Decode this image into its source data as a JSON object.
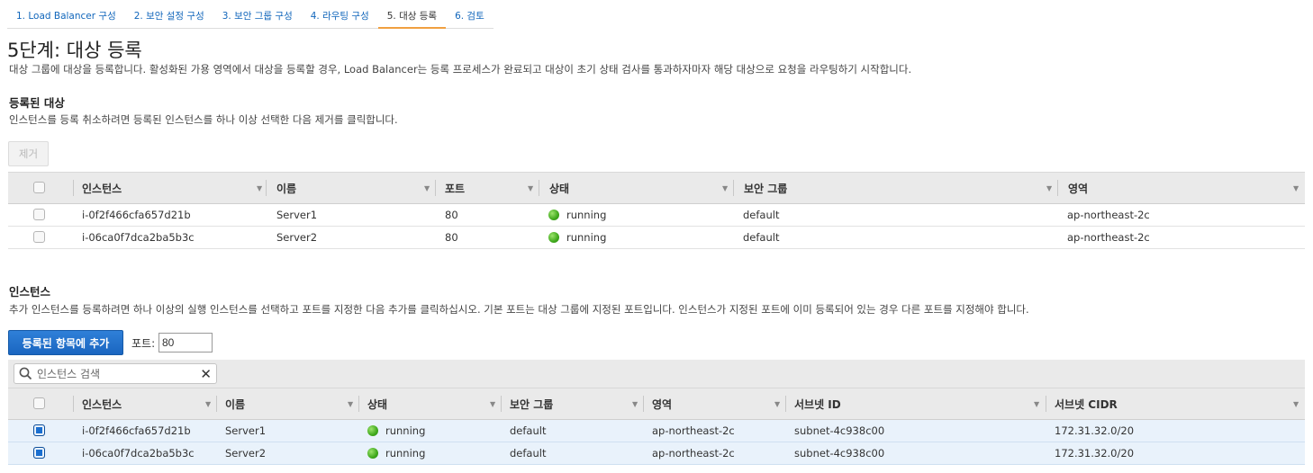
{
  "wizard": {
    "steps": [
      {
        "label": "1. Load Balancer 구성"
      },
      {
        "label": "2. 보안 설정 구성"
      },
      {
        "label": "3. 보안 그룹 구성"
      },
      {
        "label": "4. 라우팅 구성"
      },
      {
        "label": "5. 대상 등록"
      },
      {
        "label": "6. 검토"
      }
    ],
    "active_step": 4
  },
  "page": {
    "title": "5단계: 대상 등록",
    "description": "대상 그룹에 대상을 등록합니다. 활성화된 가용 영역에서 대상을 등록할 경우, Load Balancer는 등록 프로세스가 완료되고 대상이 초기 상태 검사를 통과하자마자 해당 대상으로 요청을 라우팅하기 시작합니다."
  },
  "registered": {
    "title": "등록된 대상",
    "description": "인스턴스를 등록 취소하려면 등록된 인스턴스를 하나 이상 선택한 다음 제거를 클릭합니다.",
    "remove_label": "제거",
    "columns": [
      "인스턴스",
      "이름",
      "포트",
      "상태",
      "보안 그룹",
      "영역"
    ],
    "rows": [
      {
        "instance": "i-0f2f466cfa657d21b",
        "name": "Server1",
        "port": "80",
        "status": "running",
        "security_group": "default",
        "zone": "ap-northeast-2c",
        "checked": false
      },
      {
        "instance": "i-06ca0f7dca2ba5b3c",
        "name": "Server2",
        "port": "80",
        "status": "running",
        "security_group": "default",
        "zone": "ap-northeast-2c",
        "checked": false
      }
    ]
  },
  "instances": {
    "title": "인스턴스",
    "description": "추가 인스턴스를 등록하려면 하나 이상의 실행 인스턴스를 선택하고 포트를 지정한 다음 추가를 클릭하십시오. 기본 포트는 대상 그룹에 지정된 포트입니다. 인스턴스가 지정된 포트에 이미 등록되어 있는 경우 다른 포트를 지정해야 합니다.",
    "add_label": "등록된 항목에 추가",
    "port_label": "포트:",
    "port_value": "80",
    "search_placeholder": "인스턴스 검색",
    "columns": [
      "인스턴스",
      "이름",
      "상태",
      "보안 그룹",
      "영역",
      "서브넷 ID",
      "서브넷 CIDR"
    ],
    "rows": [
      {
        "instance": "i-0f2f466cfa657d21b",
        "name": "Server1",
        "status": "running",
        "security_group": "default",
        "zone": "ap-northeast-2c",
        "subnet_id": "subnet-4c938c00",
        "subnet_cidr": "172.31.32.0/20",
        "checked": true
      },
      {
        "instance": "i-06ca0f7dca2ba5b3c",
        "name": "Server2",
        "status": "running",
        "security_group": "default",
        "zone": "ap-northeast-2c",
        "subnet_id": "subnet-4c938c00",
        "subnet_cidr": "172.31.32.0/20",
        "checked": true
      }
    ]
  },
  "colors": {
    "link": "#1166bb",
    "primary_button": "#1a66c0",
    "running": "#3fa81c",
    "selected_row": "#e9f2fb"
  },
  "icons": {
    "status": "green-dot-icon",
    "sort": "sort-down-icon",
    "search": "search-icon",
    "clear": "clear-icon"
  }
}
